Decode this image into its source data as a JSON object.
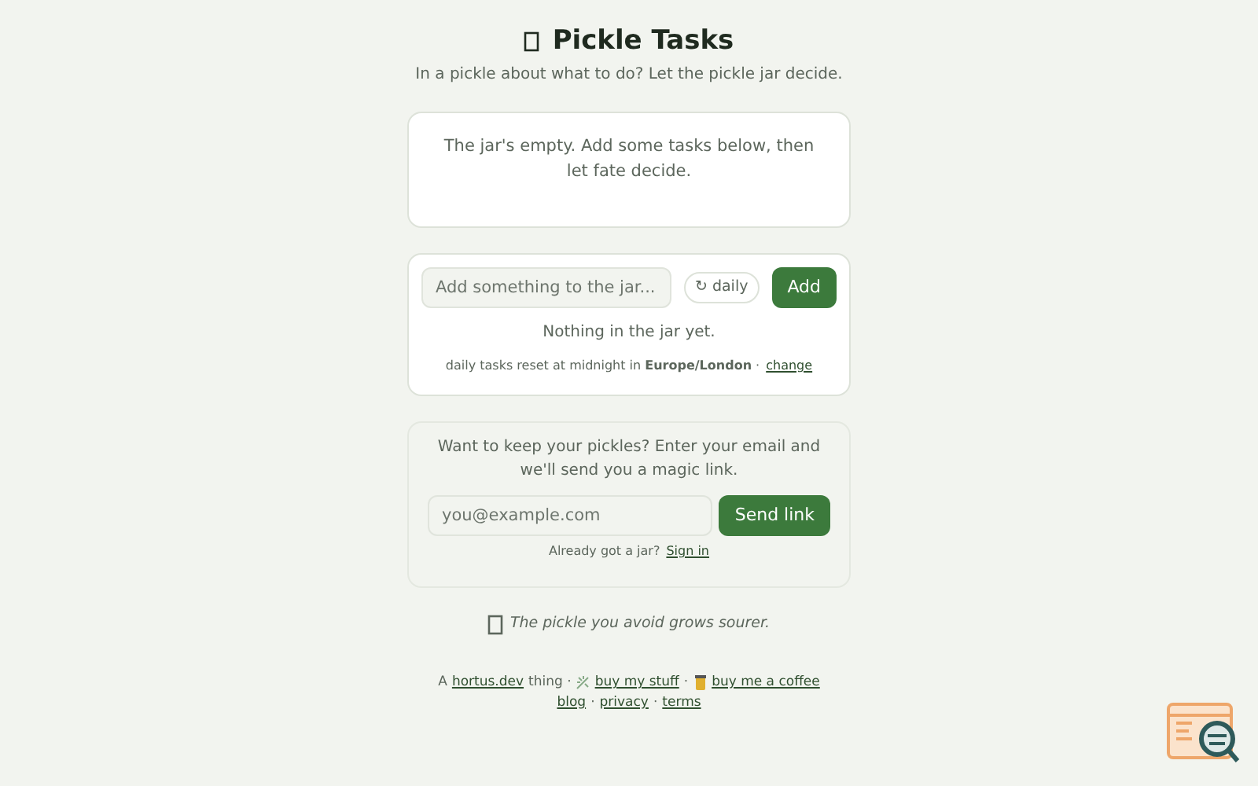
{
  "header": {
    "title": "Pickle Tasks",
    "tagline": "In a pickle about what to do? Let the pickle jar decide."
  },
  "jar": {
    "message": "The jar's empty. Add some tasks below, then let fate decide."
  },
  "add_task": {
    "placeholder": "Add something to the jar...",
    "repeat_toggle": {
      "icon": "↻",
      "label": "daily",
      "on": false
    },
    "button": "Add",
    "empty_note": "Nothing in the jar yet.",
    "reset_note": "daily tasks reset at midnight in **Europe/London** ·",
    "change_link": "change"
  },
  "signup": {
    "text": "Want to keep your pickles? Enter your email and we'll send you a magic link.",
    "placeholder": "you@example.com",
    "button": "Send link",
    "signin_text": "Already got a jar?",
    "signin_link": "Sign in"
  },
  "quote": "The pickle you avoid grows sourer.",
  "footer": {
    "lines": [
      [
        {
          "kind": "text",
          "text": "A"
        },
        {
          "kind": "link",
          "text": "hortus.dev"
        },
        {
          "kind": "text",
          "text": "thing ·"
        },
        {
          "kind": "sparkle"
        },
        {
          "kind": "link",
          "text": "buy my stuff"
        },
        {
          "kind": "text",
          "text": "·"
        },
        {
          "kind": "cup"
        },
        {
          "kind": "link",
          "text": "buy me a coffee"
        }
      ],
      [
        {
          "kind": "link",
          "text": "blog"
        },
        {
          "kind": "text",
          "text": "·"
        },
        {
          "kind": "link",
          "text": "privacy"
        },
        {
          "kind": "text",
          "text": "·"
        },
        {
          "kind": "link",
          "text": "terms"
        }
      ]
    ]
  }
}
